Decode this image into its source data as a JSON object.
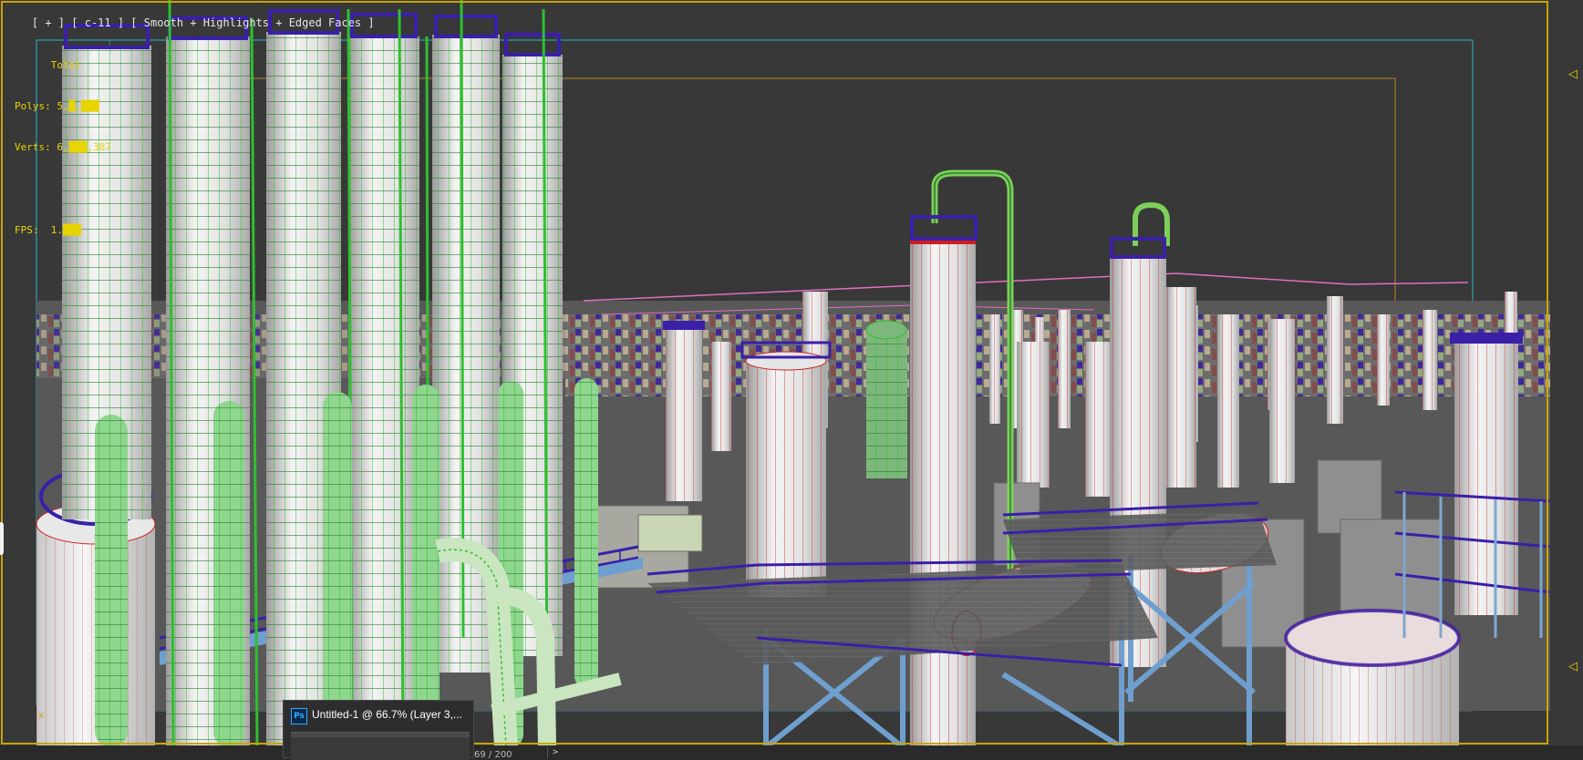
{
  "viewport": {
    "menu_plus": "[ + ]",
    "view_name": "[ c-11 ]",
    "shading": "[ Smooth + Highlights + Edged Faces ]",
    "stats": {
      "total_label": "Total",
      "polys_label": "Polys:",
      "polys_value": "5,█,███",
      "verts_label": "Verts:",
      "verts_value": "6,███,387",
      "fps_label": "FPS:",
      "fps_value": "1.███"
    }
  },
  "timeline": {
    "frame_counter": "69 / 200",
    "next_label": ">"
  },
  "taskbar_popup": {
    "app_icon": "Ps",
    "title": "Untitled-1 @ 66.7% (Layer 3,..."
  },
  "colors": {
    "viewport_border": "#c8a400",
    "stats_text": "#e8d400",
    "background": "#383838",
    "tower_wire_green": "#2fbf2f",
    "tower_wire_red": "#cc2020",
    "railing_purple": "#3a1fa8",
    "steel_blue": "#6f9fcf",
    "safe_frame_cyan": "#23b8c8",
    "safe_frame_orange": "#b88a2a"
  },
  "scene": {
    "description_icon": "industrial-plant-3d-scene"
  }
}
